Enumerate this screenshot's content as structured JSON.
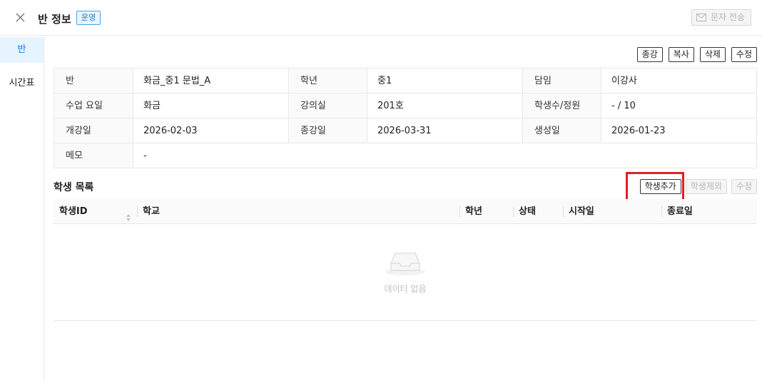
{
  "header": {
    "title": "반 정보",
    "badge": "운영",
    "sms_button": "문자 전송"
  },
  "sidebar": {
    "items": [
      {
        "label": "반",
        "active": true
      },
      {
        "label": "시간표",
        "active": false
      }
    ]
  },
  "actions": [
    "종강",
    "복사",
    "삭제",
    "수정"
  ],
  "info": {
    "row1": {
      "l1": "반",
      "v1": "화금_중1 문법_A",
      "l2": "학년",
      "v2": "중1",
      "l3": "담임",
      "v3": "이강사"
    },
    "row2": {
      "l1": "수업 요일",
      "v1": "화금",
      "l2": "강의실",
      "v2": "201호",
      "l3": "학생수/정원",
      "v3": "- / 10"
    },
    "row3": {
      "l1": "개강일",
      "v1": "2026-02-03",
      "l2": "종강일",
      "v2": "2026-03-31",
      "l3": "생성일",
      "v3": "2026-01-23"
    },
    "row4": {
      "l1": "메모",
      "v1": "-"
    }
  },
  "student_list": {
    "title": "학생 목록",
    "add_button": "학생추가",
    "remove_button": "학생제외",
    "edit_button": "수정",
    "columns": [
      "학생ID",
      "학교",
      "학년",
      "상태",
      "시작일",
      "종료일"
    ],
    "empty_text": "데이터 없음"
  },
  "colors": {
    "accent": "#1677ff",
    "highlight": "#e02020",
    "badge_border": "#4aa3e8"
  }
}
